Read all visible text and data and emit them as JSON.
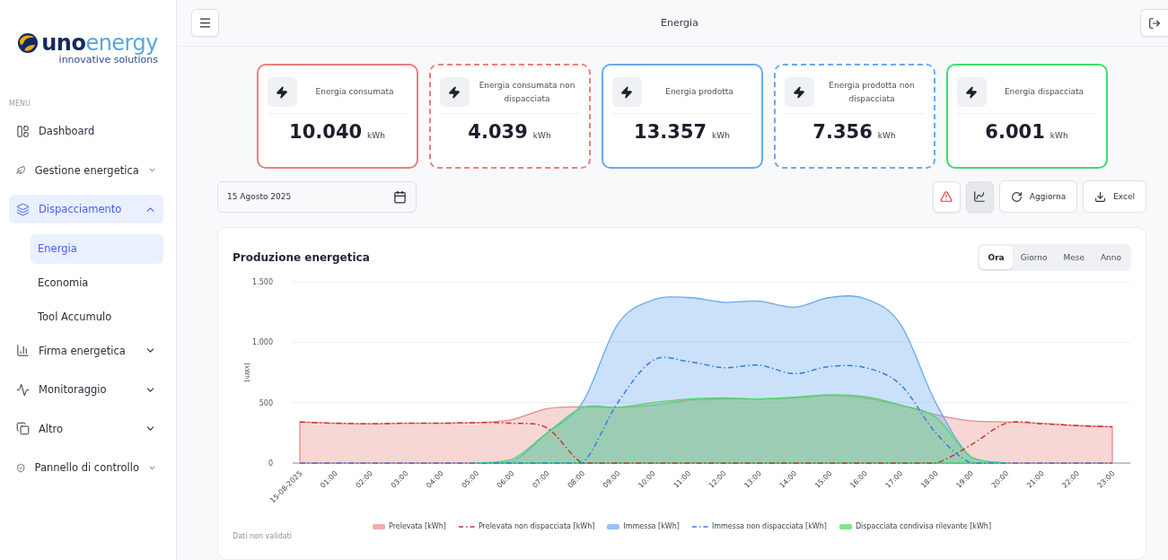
{
  "brand": {
    "name_bold": "uno",
    "name_light": "energy",
    "tagline": "innovative solutions"
  },
  "sidebar": {
    "menu_label": "MENU",
    "items": [
      {
        "label": "Dashboard",
        "selected": false
      },
      {
        "label": "Gestione energetica",
        "selected": false,
        "expanded": false
      },
      {
        "label": "Dispacciamento",
        "selected": true,
        "expanded": true,
        "children": [
          {
            "label": "Energia",
            "selected": true
          },
          {
            "label": "Economia",
            "selected": false
          },
          {
            "label": "Tool Accumulo",
            "selected": false
          }
        ]
      },
      {
        "label": "Firma energetica",
        "selected": false,
        "expanded": false
      },
      {
        "label": "Monitoraggio",
        "selected": false,
        "expanded": false
      },
      {
        "label": "Altro",
        "selected": false,
        "expanded": false
      },
      {
        "label": "Pannello di controllo",
        "selected": false,
        "expanded": false
      }
    ]
  },
  "header": {
    "title": "Energia"
  },
  "cards": [
    {
      "label": "Energia consumata",
      "value": "10.040",
      "unit": "kWh",
      "color": "#f07c7c",
      "dashed": false
    },
    {
      "label": "Energia consumata non dispacciata",
      "value": "4.039",
      "unit": "kWh",
      "color": "#f07c7c",
      "dashed": true
    },
    {
      "label": "Energia prodotta",
      "value": "13.357",
      "unit": "kWh",
      "color": "#6aa8f2",
      "dashed": false
    },
    {
      "label": "Energia prodotta non dispacciata",
      "value": "7.356",
      "unit": "kWh",
      "color": "#6aa8f2",
      "dashed": true
    },
    {
      "label": "Energia dispacciata",
      "value": "6.001",
      "unit": "kWh",
      "color": "#3ddc6e",
      "dashed": false
    }
  ],
  "date_field": {
    "value": "15 Agosto 2025"
  },
  "toolbar": [
    {
      "kind": "alert",
      "selected": false
    },
    {
      "kind": "toggle",
      "selected": true
    },
    {
      "kind": "refresh",
      "label": "Aggiorna"
    },
    {
      "kind": "excel",
      "label": "Excel"
    }
  ],
  "chart": {
    "title": "Produzione energetica",
    "tabs": [
      {
        "label": "Ora",
        "selected": true
      },
      {
        "label": "Giorno",
        "selected": false
      },
      {
        "label": "Mese",
        "selected": false
      },
      {
        "label": "Anno",
        "selected": false
      }
    ],
    "footnote": "Dati non validati",
    "chart_data": {
      "type": "area",
      "ylabel": "[kWh]",
      "ylim": [
        0,
        1500
      ],
      "yticks": [
        {
          "value": 0,
          "label": "0"
        },
        {
          "value": 500,
          "label": "500"
        },
        {
          "value": 1000,
          "label": "1.000"
        },
        {
          "value": 1500,
          "label": "1.500"
        }
      ],
      "categories": [
        "15-08-2025",
        "01:00",
        "02:00",
        "03:00",
        "04:00",
        "05:00",
        "06:00",
        "07:00",
        "08:00",
        "09:00",
        "10:00",
        "11:00",
        "12:00",
        "13:00",
        "14:00",
        "15:00",
        "16:00",
        "17:00",
        "18:00",
        "19:00",
        "20:00",
        "21:00",
        "22:00",
        "23:00"
      ],
      "series": [
        {
          "name": "Prelevata [kWh]",
          "type": "area",
          "color": "#e88a8a",
          "values": [
            340,
            330,
            325,
            330,
            330,
            335,
            360,
            450,
            465,
            460,
            480,
            520,
            530,
            530,
            540,
            560,
            540,
            480,
            400,
            350,
            340,
            330,
            310,
            300
          ]
        },
        {
          "name": "Prelevata non dispacciata [kWh]",
          "type": "line",
          "line_style": "dashed",
          "color": "#c0392b",
          "values": [
            340,
            330,
            325,
            330,
            330,
            335,
            330,
            290,
            0,
            0,
            0,
            0,
            0,
            0,
            0,
            0,
            0,
            0,
            0,
            150,
            330,
            325,
            310,
            300
          ]
        },
        {
          "name": "Immessa [kWh]",
          "type": "area",
          "color": "#6aa8f2",
          "values": [
            null,
            null,
            null,
            null,
            null,
            0,
            10,
            250,
            500,
            1150,
            1350,
            1370,
            1330,
            1340,
            1290,
            1370,
            1360,
            1150,
            500,
            50,
            0,
            null,
            null,
            null
          ]
        },
        {
          "name": "Immessa non dispacciata [kWh]",
          "type": "line",
          "line_style": "dashed",
          "color": "#2f7fe0",
          "values": [
            0,
            0,
            0,
            0,
            0,
            0,
            0,
            0,
            0,
            500,
            850,
            840,
            790,
            810,
            740,
            800,
            790,
            650,
            250,
            0,
            0,
            0,
            0,
            0
          ]
        },
        {
          "name": "Dispacciata condivisa rilevante [kWh]",
          "type": "area",
          "color": "#4cd964",
          "values": [
            null,
            null,
            null,
            null,
            null,
            0,
            30,
            250,
            460,
            460,
            500,
            530,
            540,
            530,
            545,
            565,
            550,
            480,
            380,
            50,
            0,
            null,
            null,
            null
          ]
        }
      ]
    }
  }
}
